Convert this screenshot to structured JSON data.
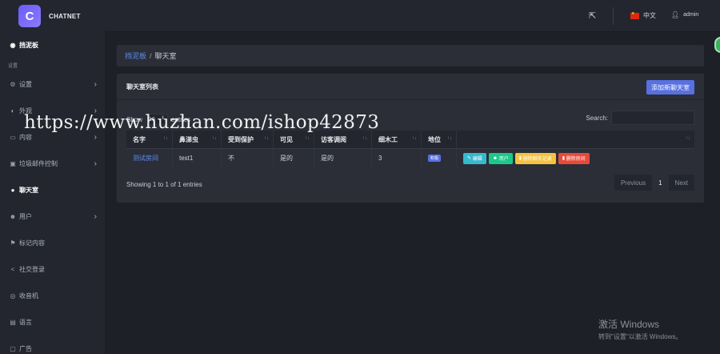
{
  "brand": {
    "name": "CHATNET",
    "logo_letter": "C"
  },
  "sidebar": {
    "items": [
      {
        "label": "挡泥板",
        "icon": "dashboard-icon",
        "glyph": "◉",
        "chevron": false,
        "active": true
      },
      {
        "section": "设置"
      },
      {
        "label": "设置",
        "icon": "gear-icon",
        "glyph": "⚙",
        "chevron": true,
        "active": false
      },
      {
        "label": "外观",
        "icon": "palette-icon",
        "glyph": "◐",
        "chevron": true,
        "active": false
      },
      {
        "label": "内容",
        "icon": "content-icon",
        "glyph": "▭",
        "chevron": true,
        "active": false
      },
      {
        "label": "垃圾邮件控制",
        "icon": "trash-icon",
        "glyph": "▣",
        "chevron": true,
        "active": false
      },
      {
        "label": "聊天室",
        "icon": "comments-icon",
        "glyph": "●",
        "chevron": false,
        "active": true
      },
      {
        "label": "用户",
        "icon": "users-icon",
        "glyph": "☻",
        "chevron": true,
        "active": false
      },
      {
        "label": "标记内容",
        "icon": "flag-icon",
        "glyph": "⚑",
        "chevron": false,
        "active": false
      },
      {
        "label": "社交登录",
        "icon": "share-icon",
        "glyph": "<",
        "chevron": false,
        "active": false
      },
      {
        "label": "收音机",
        "icon": "radio-icon",
        "glyph": "◎",
        "chevron": false,
        "active": false
      },
      {
        "label": "语言",
        "icon": "keyboard-icon",
        "glyph": "▤",
        "chevron": false,
        "active": false
      },
      {
        "label": "广告",
        "icon": "ad-icon",
        "glyph": "▢",
        "chevron": false,
        "active": false
      }
    ]
  },
  "topbar": {
    "language": "中文",
    "user": "admin",
    "external_icon": "external-link-icon"
  },
  "breadcrumb": {
    "home": "挡泥板",
    "separator": "/",
    "current": "聊天室"
  },
  "card": {
    "title": "聊天室列表",
    "add_button": "添加新聊天室"
  },
  "table_controls": {
    "show_label": "Show",
    "show_value": "10",
    "entries_label": "entries",
    "search_label": "Search:"
  },
  "table": {
    "headers": [
      "名字",
      "鼻涕虫",
      "受到保护",
      "可见",
      "访客调阅",
      "细木工",
      "地位",
      ""
    ],
    "rows": [
      {
        "name": "测试房间",
        "slug": "test1",
        "protected": "不",
        "visible": "是的",
        "guest_view": "是的",
        "joiners": "3",
        "status": "积极"
      }
    ],
    "actions": {
      "edit": "编辑",
      "users": "用户",
      "clear": "删除聊天记录",
      "delete": "删除房间"
    }
  },
  "table_info": "Showing 1 to 1 of 1 entries",
  "pagination": {
    "previous": "Previous",
    "page": "1",
    "next": "Next"
  },
  "watermark": "https://www.huzhan.com/ishop42873",
  "windows_activation": {
    "title": "激活 Windows",
    "subtitle": "转到\"设置\"以激活 Windows。"
  }
}
